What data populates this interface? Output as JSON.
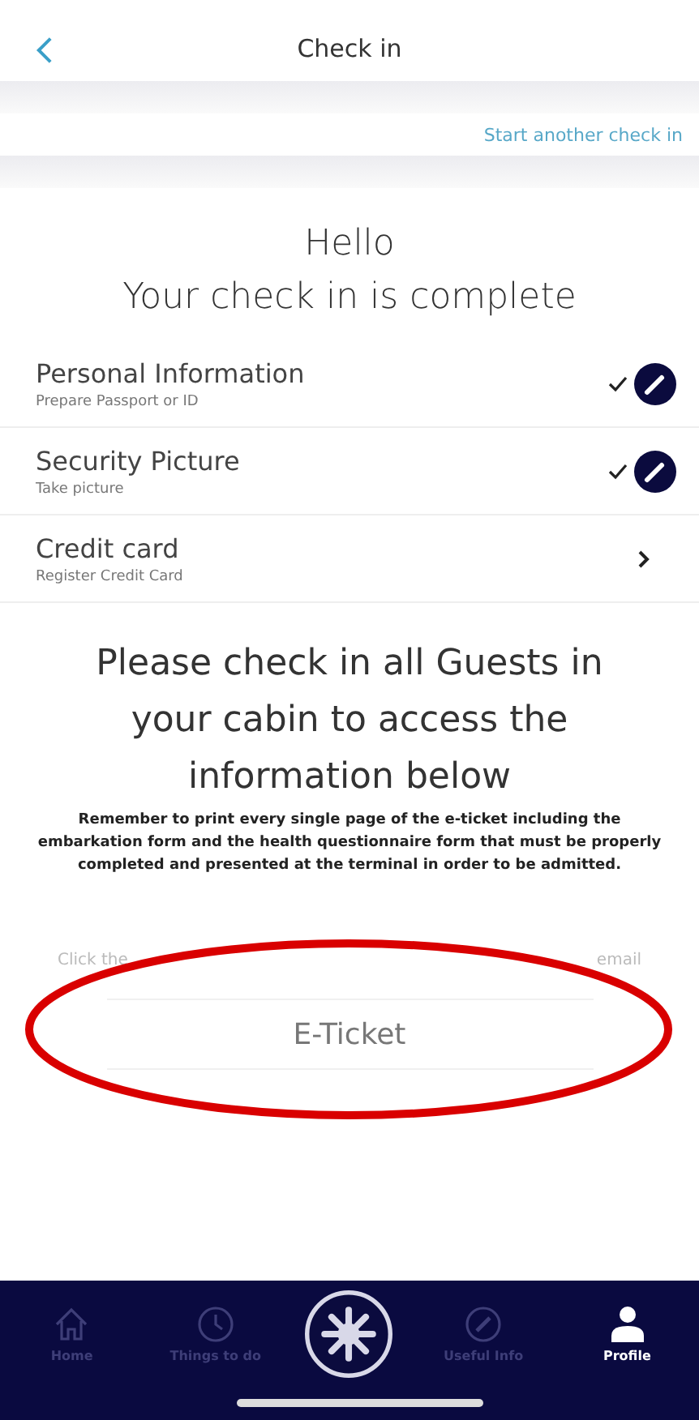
{
  "header": {
    "title": "Check in"
  },
  "start_another": "Start another check in",
  "greeting": [
    "Hello",
    "Your check in is complete"
  ],
  "steps": [
    {
      "title": "Personal Information",
      "subtitle": "Prepare Passport or ID",
      "completed": true
    },
    {
      "title": "Security Picture",
      "subtitle": "Take picture",
      "completed": true
    },
    {
      "title": "Credit card",
      "subtitle": "Register Credit Card",
      "completed": false
    }
  ],
  "notice_title": "Please check in all Guests in your cabin to access the information below",
  "notice_text": "Remember to print every single page of the e-ticket including the embarkation form and the health questionnaire form that must be properly completed and presented at the terminal in order to be admitted.",
  "hint_start": "Click the",
  "hint_end": "email",
  "eticket_button": "E-Ticket",
  "nav": [
    {
      "kind": "home",
      "label": "Home",
      "selected": false
    },
    {
      "kind": "clock",
      "label": "Things to do",
      "selected": false
    },
    {
      "kind": "center"
    },
    {
      "kind": "compass",
      "label": "Useful Info",
      "selected": false
    },
    {
      "kind": "person",
      "label": "Profile",
      "selected": true
    }
  ]
}
